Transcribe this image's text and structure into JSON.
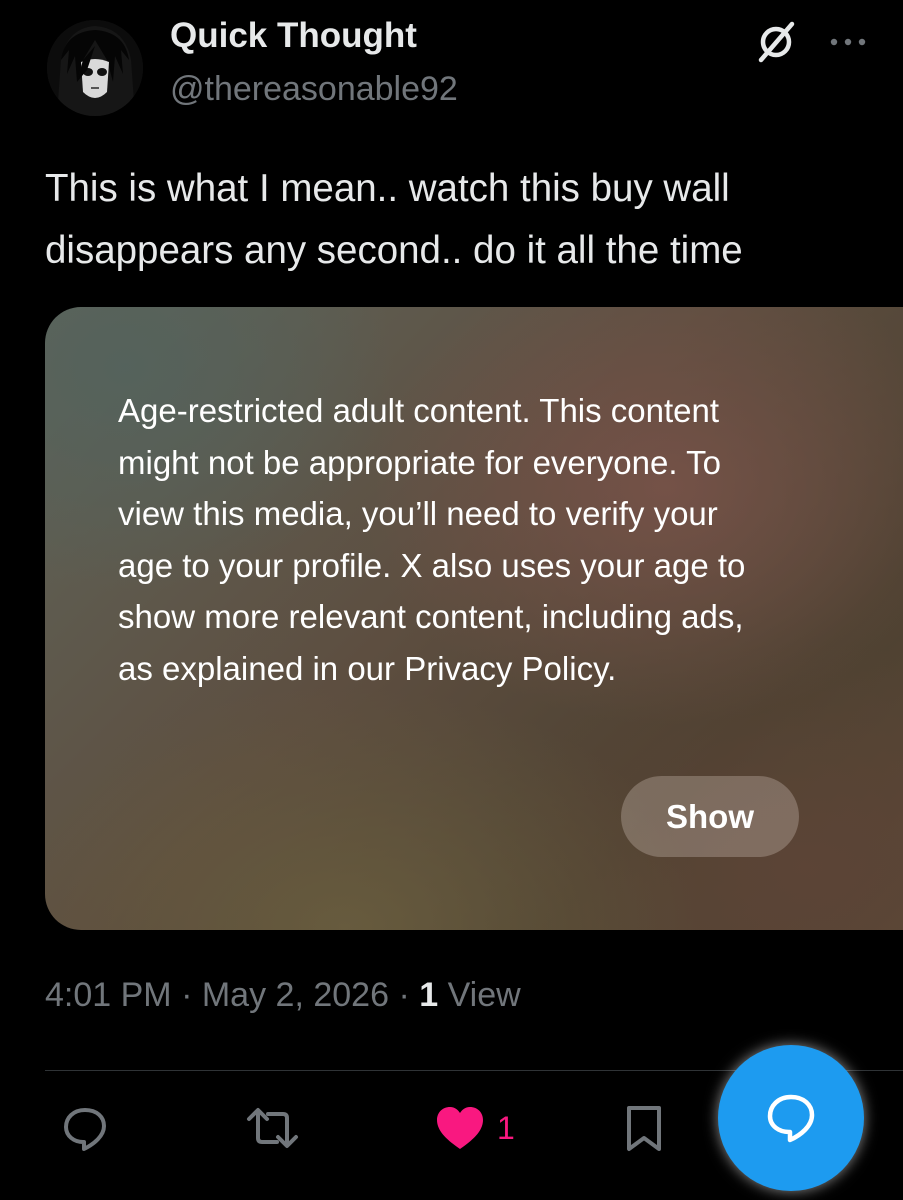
{
  "author": {
    "display_name": "Quick Thought",
    "handle": "@thereasonable92",
    "avatar_icon": "anime-avatar"
  },
  "header_icons": [
    "grok-icon",
    "more-options-icon"
  ],
  "tweet": {
    "text": "This is what I mean.. watch this buy wall disappears any second.. do it all the time"
  },
  "media": {
    "warning": "Age-restricted adult content. This content might not be appropriate for everyone. To view this media, you’ll need to verify your age to your profile. X also uses your age to show more relevant content, including ads, as explained in our Privacy Policy.",
    "show_label": "Show"
  },
  "meta": {
    "time": "4:01 PM",
    "separator": "·",
    "date": "May 2, 2026",
    "view_count": "1",
    "view_label": "View"
  },
  "actions": {
    "like_count": "1",
    "icons": [
      "reply-icon",
      "retweet-icon",
      "like-icon",
      "bookmark-icon",
      "compose-reply-icon"
    ]
  },
  "colors": {
    "background": "#000000",
    "text": "#e7e9ea",
    "muted": "#71767b",
    "like": "#f91880",
    "accent": "#1d9bf0"
  }
}
